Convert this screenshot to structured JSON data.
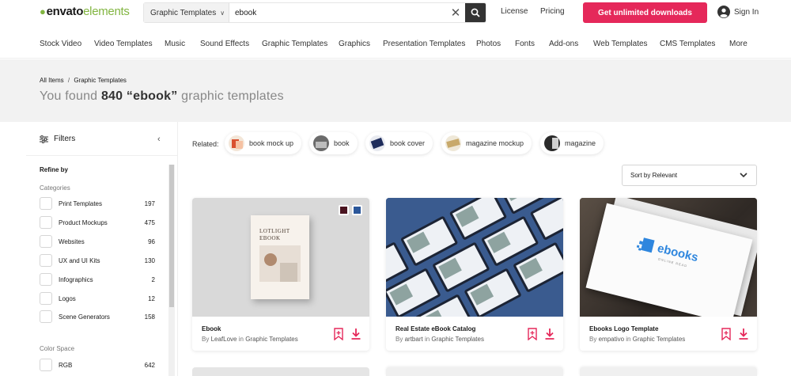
{
  "header": {
    "logo_prefix": "envato",
    "logo_suffix": "elements",
    "search_category": "Graphic Templates",
    "search_value": "ebook",
    "license": "License",
    "pricing": "Pricing",
    "cta": "Get unlimited downloads",
    "signin": "Sign In"
  },
  "nav": [
    "Stock Video",
    "Video Templates",
    "Music",
    "Sound Effects",
    "Graphic Templates",
    "Graphics",
    "Presentation Templates",
    "Photos",
    "Fonts",
    "Add-ons",
    "Web Templates",
    "CMS Templates",
    "More"
  ],
  "breadcrumb": {
    "root": "All Items",
    "sep": "/",
    "current": "Graphic Templates"
  },
  "result": {
    "prefix": "You found",
    "count": "840",
    "query": "“ebook”",
    "suffix": "graphic templates"
  },
  "sidebar": {
    "title": "Filters",
    "refine": "Refine by",
    "categories_title": "Categories",
    "categories": [
      {
        "label": "Print Templates",
        "count": "197"
      },
      {
        "label": "Product Mockups",
        "count": "475"
      },
      {
        "label": "Websites",
        "count": "96"
      },
      {
        "label": "UX and UI Kits",
        "count": "130"
      },
      {
        "label": "Infographics",
        "count": "2"
      },
      {
        "label": "Logos",
        "count": "12"
      },
      {
        "label": "Scene Generators",
        "count": "158"
      }
    ],
    "color_space_title": "Color Space",
    "color_space": [
      {
        "label": "RGB",
        "count": "642"
      }
    ]
  },
  "related": {
    "label": "Related:",
    "items": [
      "book mock up",
      "book",
      "book cover",
      "magazine mockup",
      "magazine"
    ]
  },
  "sort": {
    "label": "Sort by Relevant"
  },
  "cards": [
    {
      "title": "Ebook",
      "by": "By",
      "author": "LeafLove",
      "in": "in",
      "category": "Graphic Templates",
      "cover_line1": "LOTLIGHT",
      "cover_line2": "EBOOK"
    },
    {
      "title": "Real Estate eBook Catalog",
      "by": "By",
      "author": "artbart",
      "in": "in",
      "category": "Graphic Templates"
    },
    {
      "title": "Ebooks Logo Template",
      "by": "By",
      "author": "empativo",
      "in": "in",
      "category": "Graphic Templates",
      "logo_word": "ebooks",
      "logo_sub": "ONLINE READ"
    }
  ],
  "colors": {
    "accent": "#e5285a",
    "brand_green": "#82b541",
    "banner_bg": "#f2f2f2"
  }
}
